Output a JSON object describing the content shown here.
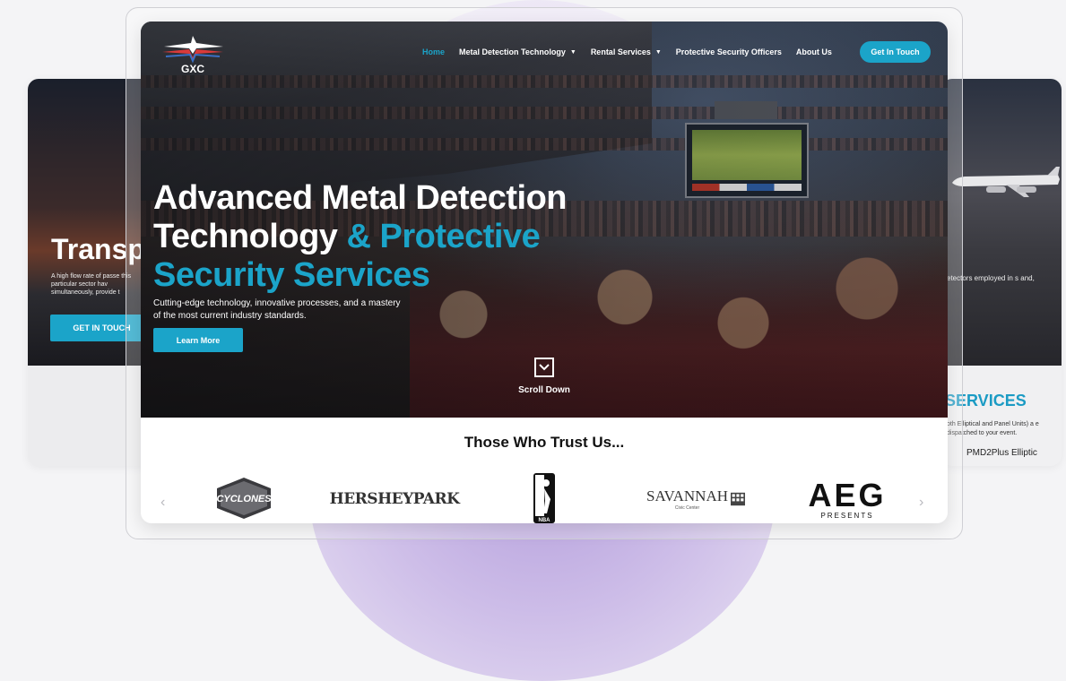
{
  "nav": {
    "items": [
      {
        "label": "Home",
        "active": true,
        "dropdown": false
      },
      {
        "label": "Metal Detection Technology",
        "active": false,
        "dropdown": true
      },
      {
        "label": "Rental Services",
        "active": false,
        "dropdown": true
      },
      {
        "label": "Protective Security Officers",
        "active": false,
        "dropdown": false
      },
      {
        "label": "About Us",
        "active": false,
        "dropdown": false
      }
    ],
    "cta_label": "Get In Touch",
    "logo_text": "GXC"
  },
  "hero": {
    "title_line1": "Advanced Metal Detection",
    "title_line2_white": "Technology ",
    "title_line2_accent": "& Protective",
    "title_line3_accent": "Security Services",
    "subtitle": "Cutting-edge technology, innovative processes, and a mastery of the most current industry standards.",
    "learn_more": "Learn More",
    "scroll_label": "Scroll Down"
  },
  "trust": {
    "title": "Those Who Trust Us...",
    "logos": [
      "CYCLONES",
      "HERSHEYPARK",
      "NBA",
      "SAVANNAH",
      "Civic Center",
      "AEG",
      "PRESENTS"
    ]
  },
  "left_card": {
    "heading": "Transp",
    "desc": "A high flow rate of passe this particular sector hav simultaneously, provide t",
    "button": "GET IN TOUCH"
  },
  "right_card": {
    "desc": "etectors employed in s and,",
    "services": "SERVICES",
    "small": "oth Elliptical and Panel Units) a e dispatched to your event.",
    "product": "PMD2Plus Elliptic"
  },
  "colors": {
    "accent": "#1ba4c9",
    "background": "#f4f4f6"
  },
  "icons": [
    "chevron-down-icon",
    "scroll-down-icon",
    "chevron-left-icon",
    "chevron-right-icon"
  ]
}
